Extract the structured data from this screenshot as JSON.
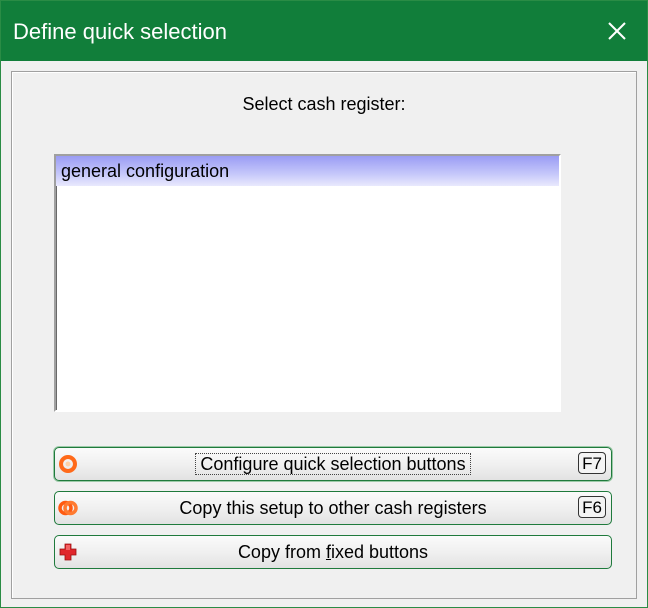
{
  "window": {
    "title": "Define quick selection"
  },
  "prompt": "Select cash register:",
  "register_list": {
    "items": [
      "general configuration"
    ],
    "selected_index": 0
  },
  "buttons": {
    "configure": {
      "label": "Configure quick selection buttons",
      "shortcut": "F7",
      "icon": "ring-icon"
    },
    "copy_setup": {
      "label": "Copy this setup to other cash registers",
      "shortcut": "F6",
      "icon": "double-ring-icon"
    },
    "copy_fixed": {
      "label_before": "Copy from ",
      "label_accel": "f",
      "label_after": "ixed buttons",
      "icon": "red-plus-icon"
    }
  },
  "colors": {
    "titlebar": "#117e3a",
    "selection": "#9a9cf4",
    "button_border": "#1f7a3c"
  }
}
